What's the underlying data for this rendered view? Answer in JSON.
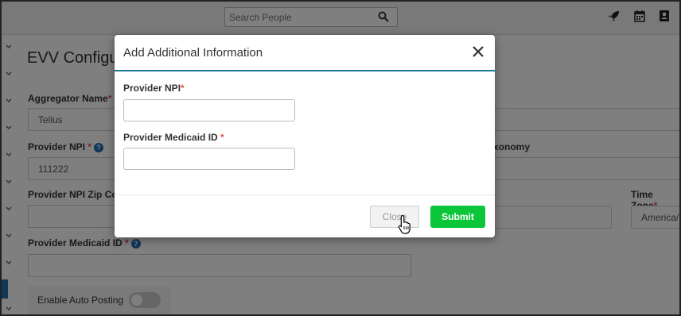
{
  "topbar": {
    "search_placeholder": "Search People",
    "icons": [
      "search-icon",
      "rocket-icon",
      "calendar-icon",
      "contact-book-icon"
    ]
  },
  "page": {
    "title": "EVV Configur",
    "fields": {
      "aggregator_label": "Aggregator Name",
      "aggregator_value": "Tellus",
      "npi_label": "Provider NPI",
      "npi_value": "111222",
      "npi_zip_label": "Provider NPI Zip Code",
      "medicaid_label": "Provider Medicaid ID",
      "right_partial_value": "e",
      "taxonomy_partial_label": "xonomy",
      "timezone_label": "Time Zone",
      "timezone_value": "America/N"
    },
    "auto_posting_label": "Enable Auto Posting"
  },
  "modal": {
    "title": "Add Additional Information",
    "fields": [
      {
        "label": "Provider NPI",
        "value": ""
      },
      {
        "label": "Provider Medicaid ID",
        "value": ""
      }
    ],
    "close_label": "Close",
    "submit_label": "Submit"
  },
  "colors": {
    "accent": "#1d7a96",
    "submit": "#0cc63a",
    "required": "#d9534f",
    "help": "#1f6fb2"
  }
}
